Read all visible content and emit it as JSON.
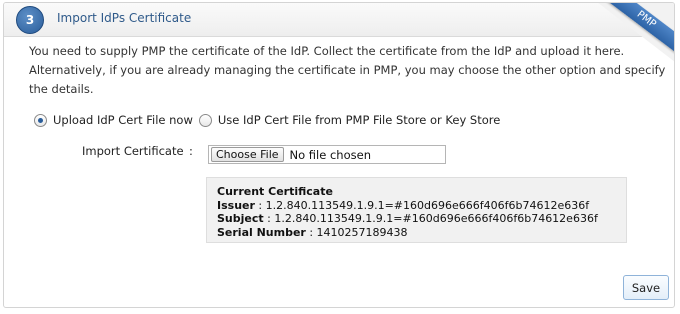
{
  "step": {
    "number": "3",
    "title": "Import IdPs Certificate"
  },
  "ribbon": {
    "label": "PMP"
  },
  "description": "You need to supply PMP the certificate of the IdP. Collect the certificate from the IdP and upload it here. Alternatively, if you are already managing the certificate in PMP, you may choose the other option and specify the details.",
  "options": [
    {
      "label": "Upload IdP Cert File now",
      "checked": true
    },
    {
      "label": "Use IdP Cert File from PMP File Store or Key Store",
      "checked": false
    }
  ],
  "import": {
    "label": "Import Certificate",
    "colon": ":",
    "choose_button": "Choose File",
    "no_file_text": "No file chosen"
  },
  "current_certificate": {
    "heading": "Current Certificate",
    "issuer_label": "Issuer",
    "issuer_value": " : 1.2.840.113549.1.9.1=#160d696e666f406f6b74612e636f",
    "subject_label": "Subject",
    "subject_value": " : 1.2.840.113549.1.9.1=#160d696e666f406f6b74612e636f",
    "serial_label": "Serial Number",
    "serial_value": " : 1410257189438"
  },
  "actions": {
    "save_label": "Save"
  }
}
